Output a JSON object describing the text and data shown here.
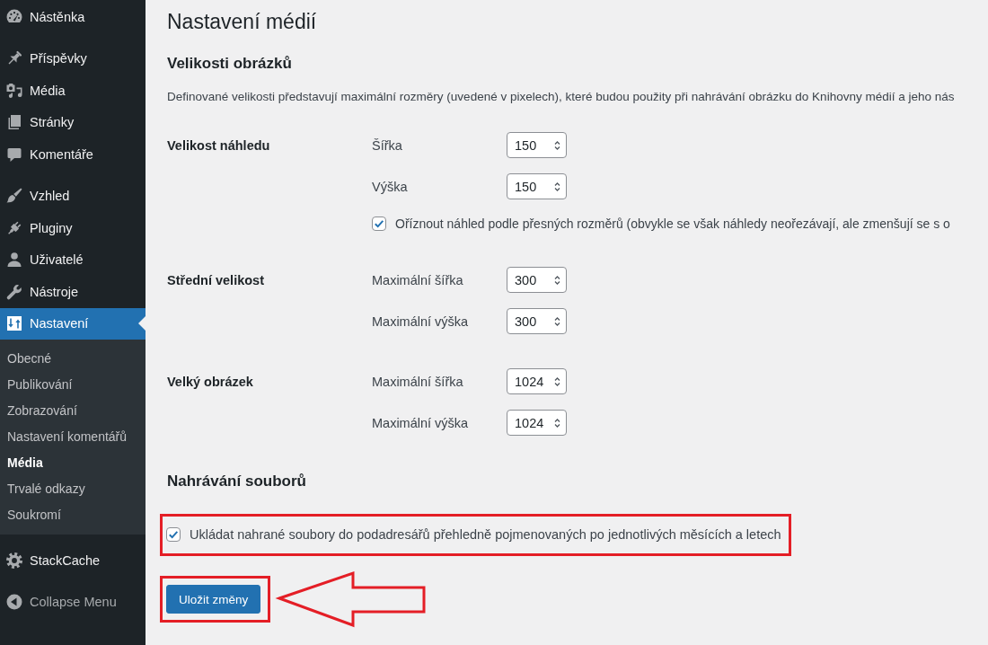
{
  "sidebar": {
    "groups": [
      {
        "items": [
          {
            "label": "Nástěnka",
            "selected": false
          }
        ]
      },
      {
        "items": [
          {
            "label": "Příspěvky",
            "selected": false
          },
          {
            "label": "Média",
            "selected": false
          },
          {
            "label": "Stránky",
            "selected": false
          },
          {
            "label": "Komentáře",
            "selected": false
          }
        ]
      },
      {
        "items": [
          {
            "label": "Vzhled",
            "selected": false
          },
          {
            "label": "Pluginy",
            "selected": false
          },
          {
            "label": "Uživatelé",
            "selected": false
          },
          {
            "label": "Nástroje",
            "selected": false
          },
          {
            "label": "Nastavení",
            "selected": true,
            "children": [
              {
                "label": "Obecné",
                "selected": false
              },
              {
                "label": "Publikování",
                "selected": false
              },
              {
                "label": "Zobrazování",
                "selected": false
              },
              {
                "label": "Nastavení komentářů",
                "selected": false
              },
              {
                "label": "Média",
                "selected": true
              },
              {
                "label": "Trvalé odkazy",
                "selected": false
              },
              {
                "label": "Soukromí",
                "selected": false
              }
            ]
          }
        ]
      },
      {
        "items": [
          {
            "label": "StackCache",
            "selected": false
          }
        ]
      }
    ],
    "collapse_label": "Collapse Menu"
  },
  "page_title": "Nastavení médií",
  "sections": [
    {
      "heading": "Velikosti obrázků",
      "description": "Definované velikosti představují maximální rozměry (uvedené v pixelech), které budou použity při nahrávání obrázku do Knihovny médií a jeho nás",
      "rows": [
        {
          "label": "Velikost náhledu",
          "fields": [
            {
              "kind": "number",
              "label": "Šířka",
              "value": "150"
            },
            {
              "kind": "number",
              "label": "Výška",
              "value": "150"
            },
            {
              "kind": "checkbox",
              "label": "Oříznout náhled podle přesných rozměrů (obvykle se však náhledy neořezávají, ale zmenšují se s o",
              "checked": true
            }
          ]
        },
        {
          "label": "Střední velikost",
          "fields": [
            {
              "kind": "number",
              "label": "Maximální šířka",
              "value": "300"
            },
            {
              "kind": "number",
              "label": "Maximální výška",
              "value": "300"
            }
          ]
        },
        {
          "label": "Velký obrázek",
          "fields": [
            {
              "kind": "number",
              "label": "Maximální šířka",
              "value": "1024"
            },
            {
              "kind": "number",
              "label": "Maximální výška",
              "value": "1024"
            }
          ]
        }
      ]
    },
    {
      "heading": "Nahrávání souborů",
      "options": [
        {
          "label": "Ukládat nahrané soubory do podadresářů přehledně pojmenovaných po jednotlivých měsících a letech",
          "checked": true,
          "highlighted": true
        }
      ]
    }
  ],
  "save_button": {
    "label": "Uložit změny",
    "highlighted": true,
    "arrow": true
  }
}
